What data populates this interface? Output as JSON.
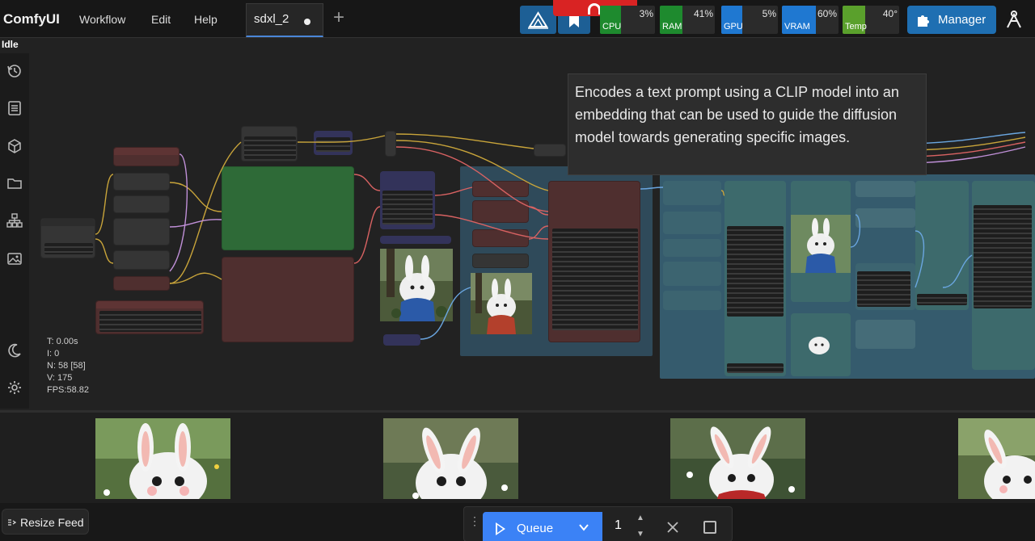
{
  "app": {
    "title": "ComfyUI"
  },
  "menu": {
    "workflow": "Workflow",
    "edit": "Edit",
    "help": "Help"
  },
  "tabs": [
    {
      "label": "sdxl_2",
      "unsaved": true
    }
  ],
  "monitors": [
    {
      "label": "CPU",
      "value": "3%",
      "percent": 3,
      "color": "#1e8a2e"
    },
    {
      "label": "RAM",
      "value": "41%",
      "percent": 41,
      "color": "#1e8a2e"
    },
    {
      "label": "GPU",
      "value": "5%",
      "percent": 5,
      "color": "#1f78d1"
    },
    {
      "label": "VRAM",
      "value": "60%",
      "percent": 60,
      "color": "#1f78d1"
    },
    {
      "label": "Temp",
      "value": "40°",
      "percent": 40,
      "color": "#5aa02c"
    }
  ],
  "manager": {
    "label": "Manager"
  },
  "status": {
    "text": "Idle"
  },
  "tooltip": {
    "text": "Encodes a text prompt using a CLIP model into an embedding that can be used to guide the diffusion model towards generating specific images."
  },
  "stats": {
    "t": "T: 0.00s",
    "i": "I: 0",
    "n": "N: 58 [58]",
    "v": "V: 175",
    "fps": "FPS:58.82"
  },
  "sidebar": {
    "icons": [
      "history-icon",
      "queue-list-icon",
      "model-library-icon",
      "workflows-folder-icon",
      "node-library-icon",
      "image-gallery-icon",
      "theme-toggle-icon",
      "settings-gear-icon"
    ]
  },
  "feed": {
    "resize_label": "Resize Feed"
  },
  "queue": {
    "label": "Queue",
    "batch_count": "1"
  }
}
